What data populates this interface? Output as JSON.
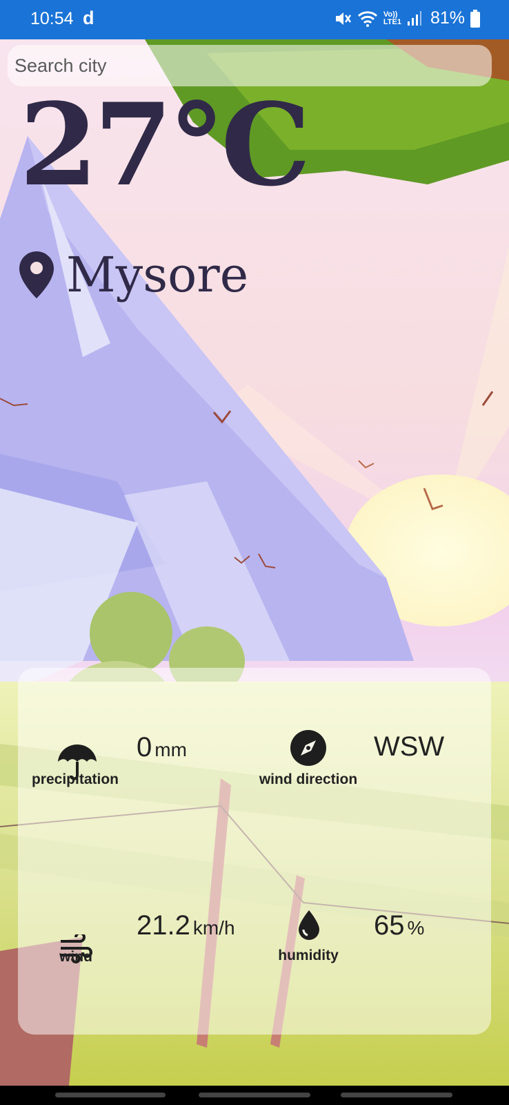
{
  "status_bar": {
    "time": "10:54",
    "app_indicator": "d",
    "battery_percent": "81%",
    "signal_label_top": "Vo))",
    "signal_label_bottom": "LTE1"
  },
  "search": {
    "placeholder": "Search city"
  },
  "weather": {
    "temperature": "27°C",
    "city": "Mysore"
  },
  "details": {
    "precipitation": {
      "label": "precipitation",
      "value": "0",
      "unit": "mm"
    },
    "wind_direction": {
      "label": "wind direction",
      "value": "WSW"
    },
    "wind": {
      "label": "wind",
      "value": "21.2",
      "unit": "km/h"
    },
    "humidity": {
      "label": "humidity",
      "value": "65",
      "unit": "%"
    }
  },
  "icons": {
    "location": "location-pin-icon",
    "precipitation": "umbrella-icon",
    "wind_direction": "compass-icon",
    "wind": "wind-icon",
    "humidity": "droplet-icon"
  },
  "colors": {
    "status_bar": "#1a73d6",
    "text_dark": "#302a48"
  }
}
